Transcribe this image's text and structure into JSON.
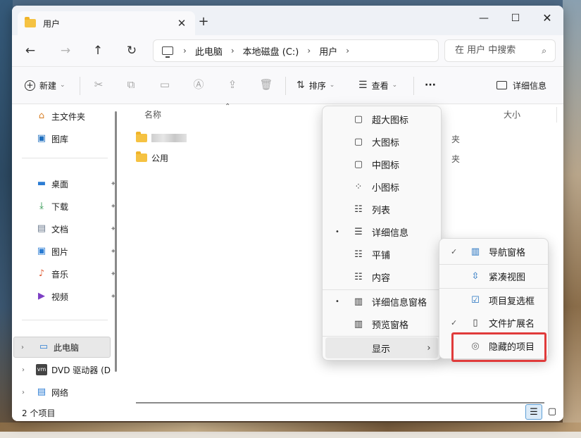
{
  "tab": {
    "title": "用户",
    "close": "✕",
    "new_tab": "+"
  },
  "window_controls": {
    "minimize": "—",
    "maximize": "☐",
    "close": "✕"
  },
  "nav": {
    "back": "←",
    "forward": "→",
    "up": "↑",
    "refresh": "↻"
  },
  "address": {
    "crumbs": [
      "此电脑",
      "本地磁盘 (C:)",
      "用户"
    ],
    "sep": "›"
  },
  "search": {
    "placeholder": "在 用户 中搜索",
    "icon": "⌕"
  },
  "toolbar": {
    "new_label": "新建",
    "sort_label": "排序",
    "view_label": "查看",
    "more_label": "···",
    "details_label": "详细信息",
    "caret": "⌄"
  },
  "sidebar": {
    "home": "主文件夹",
    "gallery": "图库",
    "quick": [
      {
        "label": "桌面",
        "icon": "▬"
      },
      {
        "label": "下载",
        "icon": "⤓"
      },
      {
        "label": "文档",
        "icon": "▤"
      },
      {
        "label": "图片",
        "icon": "▣"
      },
      {
        "label": "音乐",
        "icon": "♪"
      },
      {
        "label": "视频",
        "icon": "▶"
      }
    ],
    "pin": "📌",
    "this_pc": "此电脑",
    "dvd": "DVD 驱动器 (D",
    "network": "网络",
    "expander": "›"
  },
  "columns": {
    "name": "名称",
    "size": "大小",
    "sort_arrow": "⌃"
  },
  "files": [
    {
      "name": ""
    },
    {
      "name": "公用"
    }
  ],
  "file_type_partial": "夹",
  "status": {
    "count": "2 个项目"
  },
  "view_menu": [
    {
      "label": "超大图标",
      "icon": "▢"
    },
    {
      "label": "大图标",
      "icon": "▢"
    },
    {
      "label": "中图标",
      "icon": "▢"
    },
    {
      "label": "小图标",
      "icon": "⁘"
    },
    {
      "label": "列表",
      "icon": "☷"
    },
    {
      "label": "详细信息",
      "icon": "☰",
      "bullet": "•"
    },
    {
      "label": "平铺",
      "icon": "☷"
    },
    {
      "label": "内容",
      "icon": "☷"
    },
    {
      "label": "详细信息窗格",
      "icon": "▥",
      "bullet": "•"
    },
    {
      "label": "预览窗格",
      "icon": "▥"
    },
    {
      "label": "显示",
      "arrow": "›"
    }
  ],
  "show_menu": [
    {
      "label": "导航窗格",
      "icon": "▥",
      "check": "✓"
    },
    {
      "label": "紧凑视图",
      "icon": "⇳"
    },
    {
      "label": "项目复选框",
      "icon": "☑"
    },
    {
      "label": "文件扩展名",
      "icon": "▯",
      "check": "✓"
    },
    {
      "label": "隐藏的项目",
      "icon": "◎"
    }
  ],
  "colors": {
    "highlight": "#e03b3b",
    "accent": "#0067c0",
    "folder": "#f5c242"
  }
}
